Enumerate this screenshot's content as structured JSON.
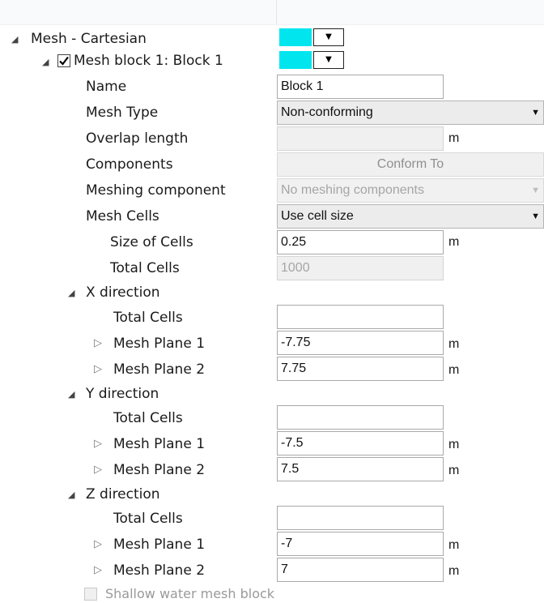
{
  "mesh_root": {
    "label": "Mesh - Cartesian",
    "color": "#00e5ee"
  },
  "mesh_block": {
    "label": "Mesh block 1: Block 1",
    "checked": true,
    "color": "#00e5ee"
  },
  "props": {
    "name": {
      "label": "Name",
      "value": "Block 1"
    },
    "mesh_type": {
      "label": "Mesh Type",
      "value": "Non-conforming"
    },
    "overlap_length": {
      "label": "Overlap length",
      "value": "",
      "unit": "m"
    },
    "components": {
      "label": "Components",
      "button": "Conform To"
    },
    "meshing_component": {
      "label": "Meshing component",
      "value": "No meshing components"
    },
    "mesh_cells": {
      "label": "Mesh Cells",
      "value": "Use cell size"
    },
    "size_of_cells": {
      "label": "Size of Cells",
      "value": "0.25",
      "unit": "m"
    },
    "total_cells": {
      "label": "Total Cells",
      "value": "1000"
    }
  },
  "directions": [
    {
      "label": "X direction",
      "total_cells_label": "Total Cells",
      "total_cells": "",
      "planes": [
        {
          "label": "Mesh Plane 1",
          "value": "-7.75",
          "unit": "m"
        },
        {
          "label": "Mesh Plane 2",
          "value": "7.75",
          "unit": "m"
        }
      ]
    },
    {
      "label": "Y direction",
      "total_cells_label": "Total Cells",
      "total_cells": "",
      "planes": [
        {
          "label": "Mesh Plane 1",
          "value": "-7.5",
          "unit": "m"
        },
        {
          "label": "Mesh Plane 2",
          "value": "7.5",
          "unit": "m"
        }
      ]
    },
    {
      "label": "Z direction",
      "total_cells_label": "Total Cells",
      "total_cells": "",
      "planes": [
        {
          "label": "Mesh Plane 1",
          "value": "-7",
          "unit": "m"
        },
        {
          "label": "Mesh Plane 2",
          "value": "7",
          "unit": "m"
        }
      ]
    }
  ],
  "shallow_water": {
    "label": "Shallow water mesh block",
    "checked": false
  },
  "icons": {
    "expanded": "triangle-expanded-icon",
    "collapsed": "triangle-collapsed-icon",
    "dropdown": "dropdown-arrow-icon",
    "check": "checkmark-icon"
  },
  "glyphs": {
    "expanded": "◢",
    "collapsed": "▷",
    "dropdown": "▼"
  }
}
